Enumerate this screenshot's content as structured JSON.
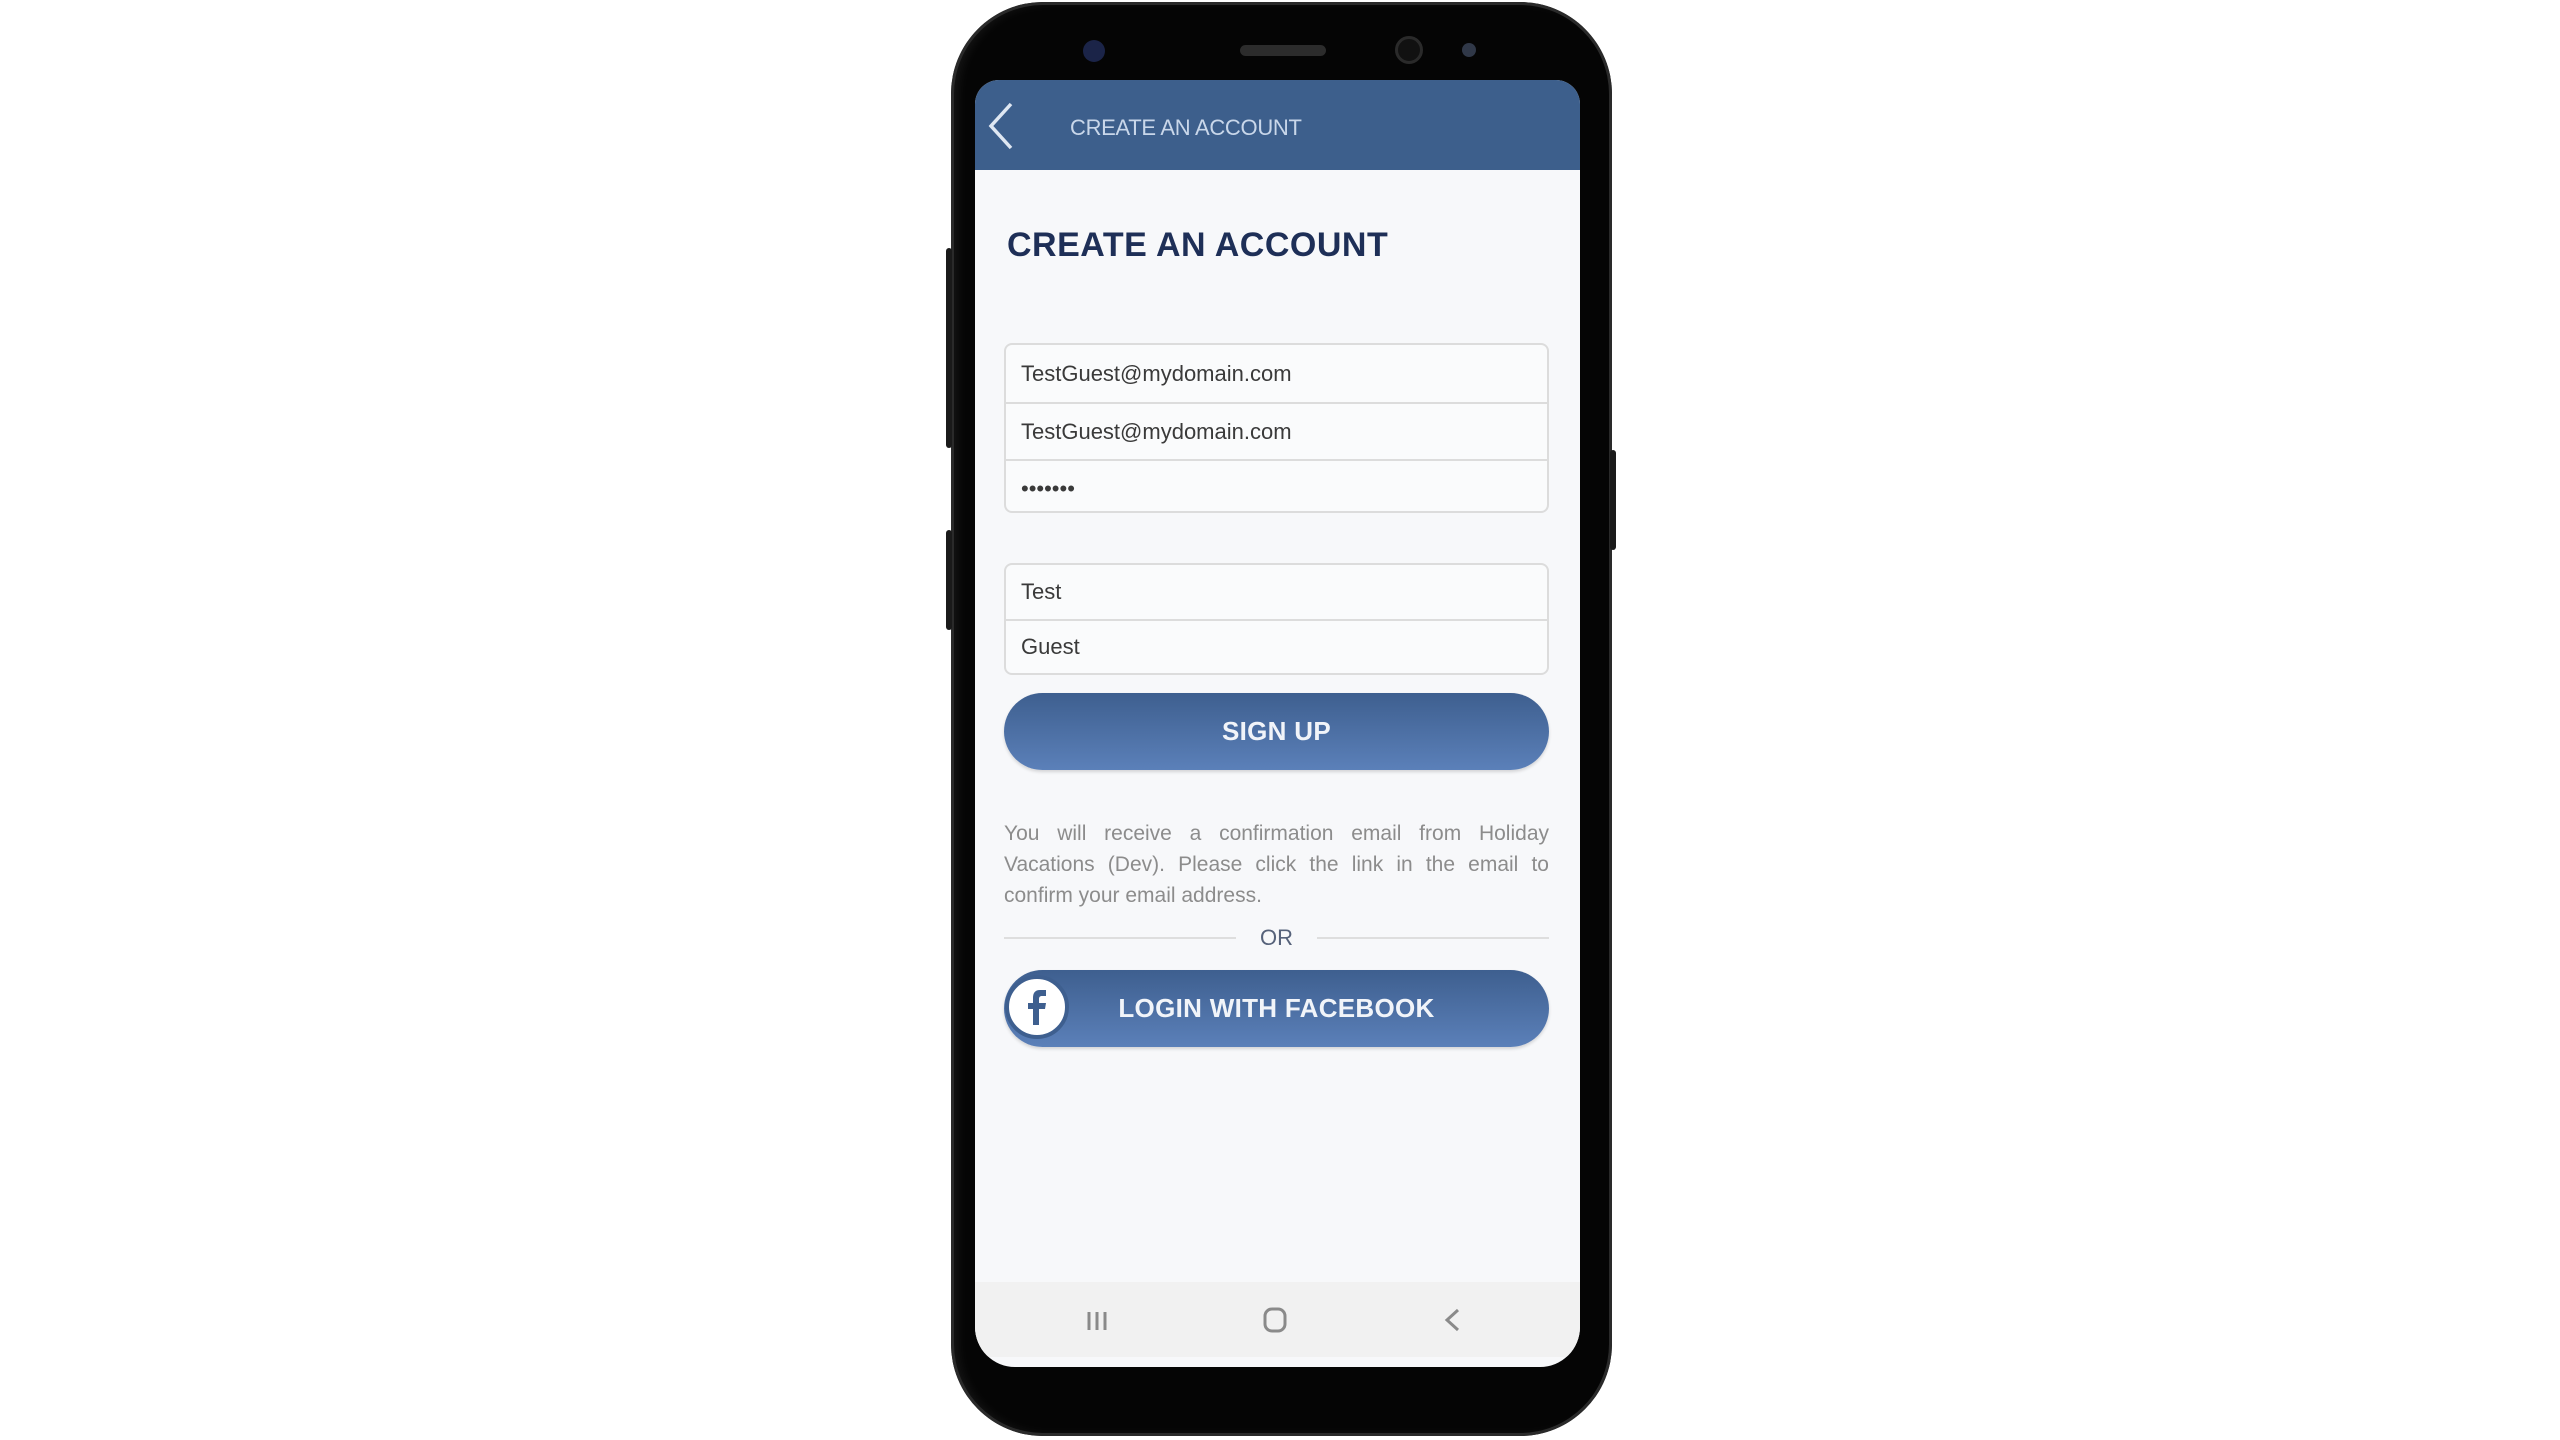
{
  "device": {
    "type": "smartphone"
  },
  "header": {
    "back_icon": "chevron-left-icon",
    "title": "CREATE AN ACCOUNT",
    "background": "#3d5f8c"
  },
  "page": {
    "title": "CREATE AN ACCOUNT",
    "title_color": "#1e2f57"
  },
  "credentials_fields": [
    {
      "name": "email",
      "value": "TestGuest@mydomain.com"
    },
    {
      "name": "confirm-email",
      "value": "TestGuest@mydomain.com"
    },
    {
      "name": "password",
      "value": "•••••••"
    }
  ],
  "name_fields": [
    {
      "name": "first-name",
      "value": "Test"
    },
    {
      "name": "last-name",
      "value": "Guest"
    }
  ],
  "signup_button": {
    "label": "SIGN UP"
  },
  "info_text": "You will receive a confirmation email from Holiday Vacations (Dev). Please click the link in the email to confirm your email address.",
  "divider_label": "OR",
  "facebook_button": {
    "label": "LOGIN WITH FACEBOOK",
    "icon": "facebook-icon"
  },
  "navbar": {
    "recents_icon": "recents-icon",
    "home_icon": "home-icon",
    "back_icon": "back-icon"
  },
  "colors": {
    "accent": "#3e5f8f",
    "accent_light": "#5b80b9",
    "text_muted": "#8c8c8c"
  }
}
